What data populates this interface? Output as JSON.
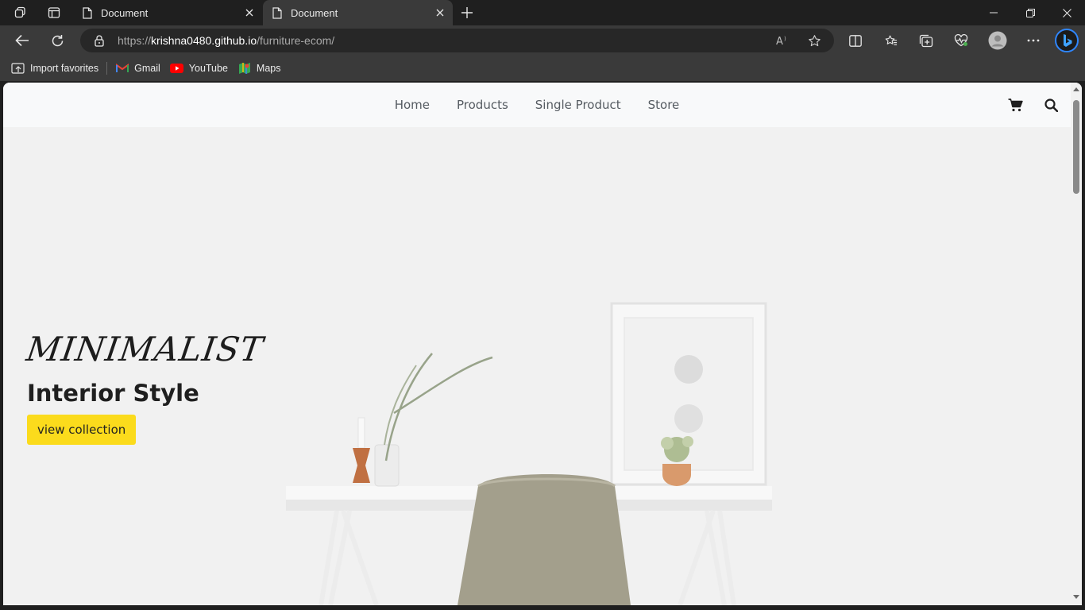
{
  "browser": {
    "tabs": [
      {
        "title": "Document",
        "active": false
      },
      {
        "title": "Document",
        "active": true
      }
    ],
    "url": {
      "scheme": "https://",
      "host": "krishna0480.github.io",
      "path": "/furniture-ecom/"
    },
    "favorites": [
      {
        "label": "Import favorites",
        "icon": "import-favorites-icon"
      },
      {
        "label": "Gmail",
        "icon": "gmail-icon"
      },
      {
        "label": "YouTube",
        "icon": "youtube-icon"
      },
      {
        "label": "Maps",
        "icon": "maps-icon"
      }
    ]
  },
  "site": {
    "nav": {
      "links": [
        "Home",
        "Products",
        "Single Product",
        "Store"
      ],
      "icons": [
        "cart-icon",
        "search-icon"
      ]
    },
    "hero": {
      "script_title": "MINIMALIST",
      "subtitle": "Interior Style",
      "cta_label": "view collection"
    }
  },
  "colors": {
    "chrome_dark": "#1f1f1f",
    "chrome_mid": "#3a3a3a",
    "cta_yellow": "#fbdb1c",
    "nav_bg": "#f8f9fa"
  }
}
